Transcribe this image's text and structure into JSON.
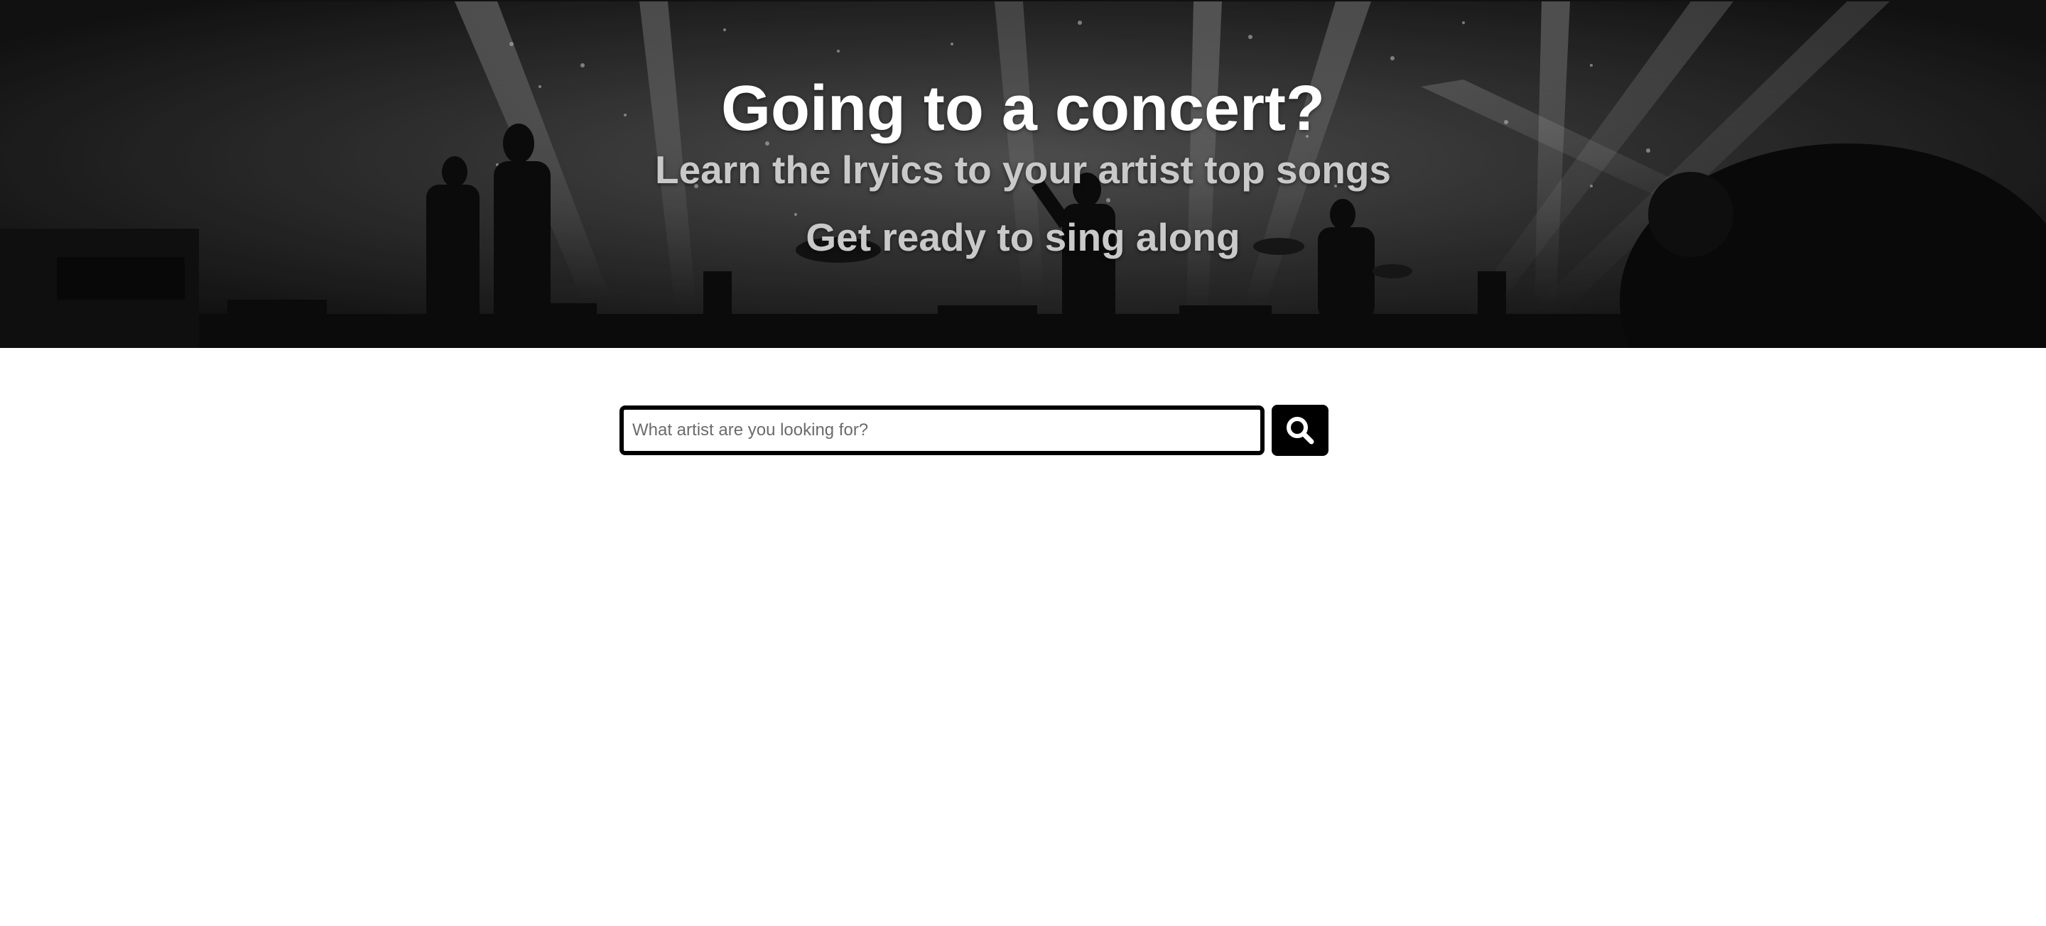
{
  "hero": {
    "title": "Going to a concert?",
    "subtitle": "Learn the lryics to your artist top songs",
    "tagline": "Get ready to sing along"
  },
  "search": {
    "placeholder": "What artist are you looking for?",
    "value": "",
    "button_icon": "search-icon"
  },
  "colors": {
    "hero_overlay": "#1c1c1c",
    "title_text": "#ffffff",
    "subtitle_text": "#c9c9c9",
    "button_bg": "#000000",
    "page_bg": "#ffffff"
  }
}
